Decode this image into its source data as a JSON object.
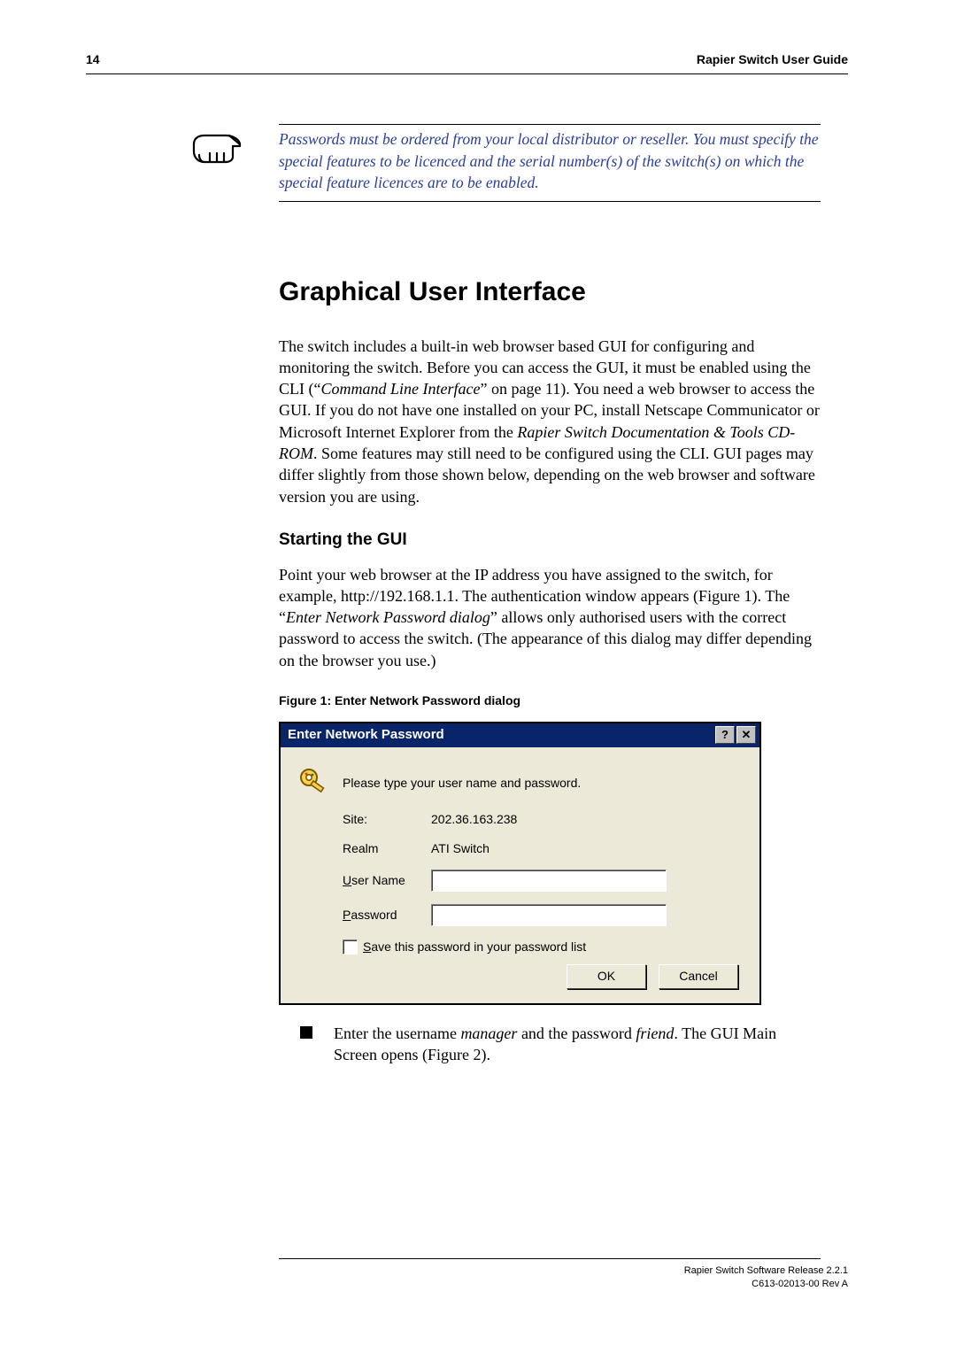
{
  "page_number": "14",
  "doc_title": "Rapier Switch User Guide",
  "note_text": "Passwords must be ordered from your local distributor or reseller. You must specify the special features to be licenced and the serial number(s) of the switch(s) on which the special feature licences are to be enabled.",
  "section_heading": "Graphical User Interface",
  "body_para_html": "The switch includes a built-in web browser based GUI for configuring and monitoring the switch. Before you can access the GUI, it must be enabled using the CLI (“<em>Command Line Interface</em>” on page 11). You need a web browser to access the GUI. If you do not have one installed on your PC, install Netscape Communicator or Microsoft Internet Explorer from the <em>Rapier Switch Documentation & Tools CD-ROM</em>. Some features may still need to be configured using the CLI. GUI pages may differ slightly from those shown below, depending on the web browser and software version you are using.",
  "subsection_heading": "Starting the GUI",
  "starting_para_html": "Point your web browser at the IP address you have assigned to the switch, for example, http://192.168.1.1. The authentication window appears (Figure 1). The “<em>Enter Network Password dialog</em>” allows only authorised users with the correct password to access the switch. (The appearance of this dialog may differ depending on the browser you use.)",
  "figure_caption": "Figure 1: Enter Network Password dialog",
  "dialog": {
    "title": "Enter Network Password",
    "help_btn": "?",
    "close_btn": "✕",
    "message": "Please type your user name and password.",
    "site_label": "Site:",
    "site_value": "202.36.163.238",
    "realm_label": "Realm",
    "realm_value": "ATI Switch",
    "user_label_pre": "U",
    "user_label_post": "ser Name",
    "pass_label_pre": "P",
    "pass_label_post": "assword",
    "save_pre": "S",
    "save_post": "ave this password in your password list",
    "ok": "OK",
    "cancel": "Cancel"
  },
  "bullet_html": "Enter the username <em>manager</em> and the password <em>friend</em>. The GUI Main Screen opens (Figure 2).",
  "footer_line1": "Rapier Switch Software Release 2.2.1",
  "footer_line2": "C613-02013-00 Rev A"
}
